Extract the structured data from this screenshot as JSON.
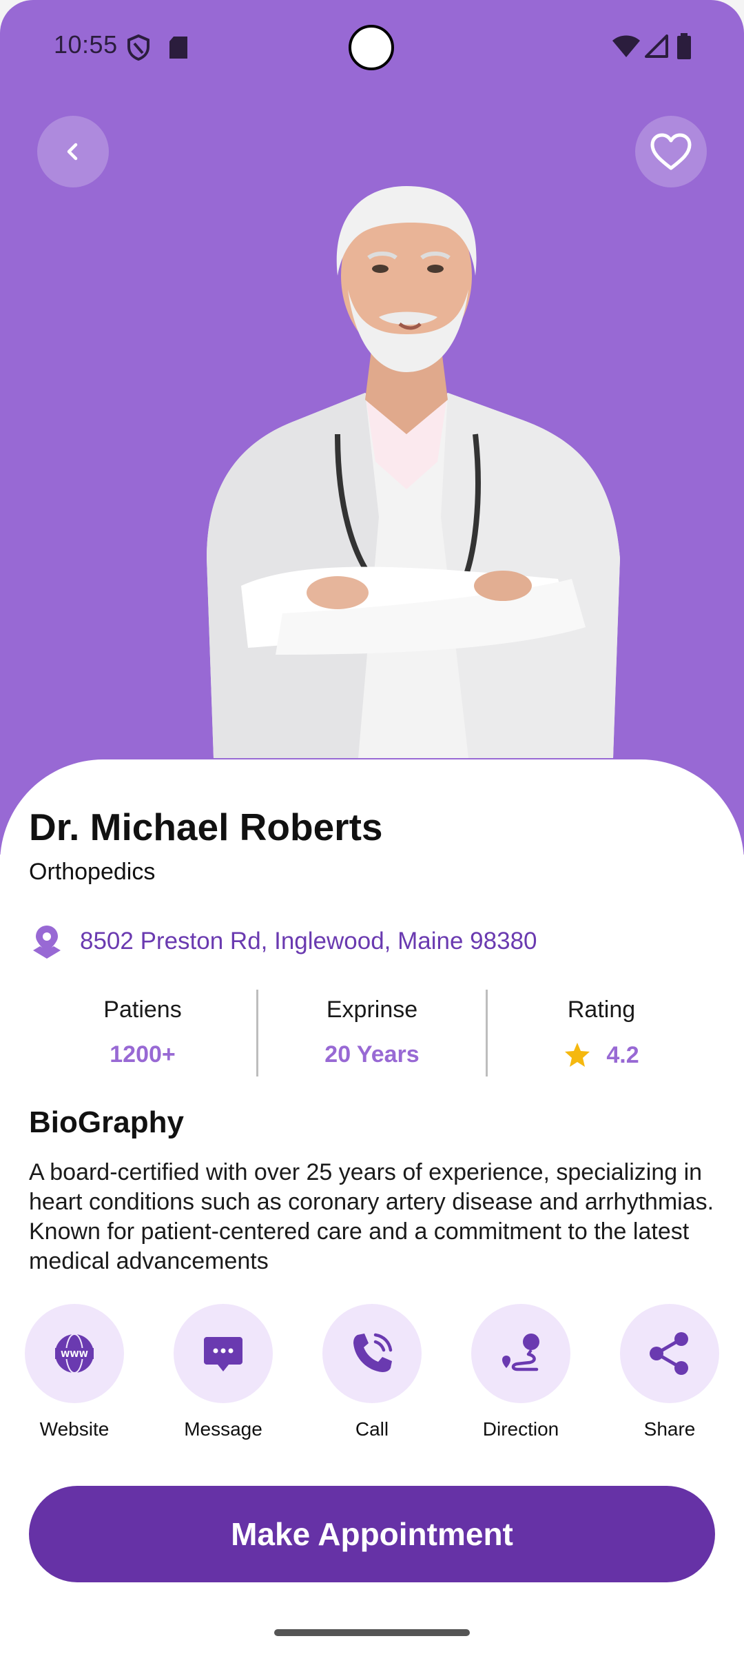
{
  "status_bar": {
    "time": "10:55"
  },
  "header": {
    "back_icon": "chevron-left-icon",
    "favorite_icon": "heart-outline-icon"
  },
  "doctor": {
    "name": "Dr. Michael Roberts",
    "specialty": "Orthopedics",
    "address": "8502 Preston Rd, Inglewood, Maine 98380"
  },
  "stats": [
    {
      "label": "Patiens",
      "value": "1200+"
    },
    {
      "label": "Exprinse",
      "value": "20 Years"
    },
    {
      "label": "Rating",
      "value": "4.2"
    }
  ],
  "biography": {
    "title": "BioGraphy",
    "text": "A board-certified with over 25 years of experience, specializing in heart conditions such as coronary artery disease and arrhythmias. Known for patient-centered care and a commitment to the latest medical advancements"
  },
  "actions": [
    {
      "label": "Website",
      "icon": "globe-www-icon"
    },
    {
      "label": "Message",
      "icon": "message-bubble-icon"
    },
    {
      "label": "Call",
      "icon": "phone-icon"
    },
    {
      "label": "Direction",
      "icon": "route-icon"
    },
    {
      "label": "Share",
      "icon": "share-icon"
    }
  ],
  "cta": {
    "label": "Make Appointment"
  },
  "colors": {
    "primary": "#9869d4",
    "primary_dark": "#6632a6",
    "action_bg": "#f0e6fb",
    "star": "#f5b80f"
  }
}
